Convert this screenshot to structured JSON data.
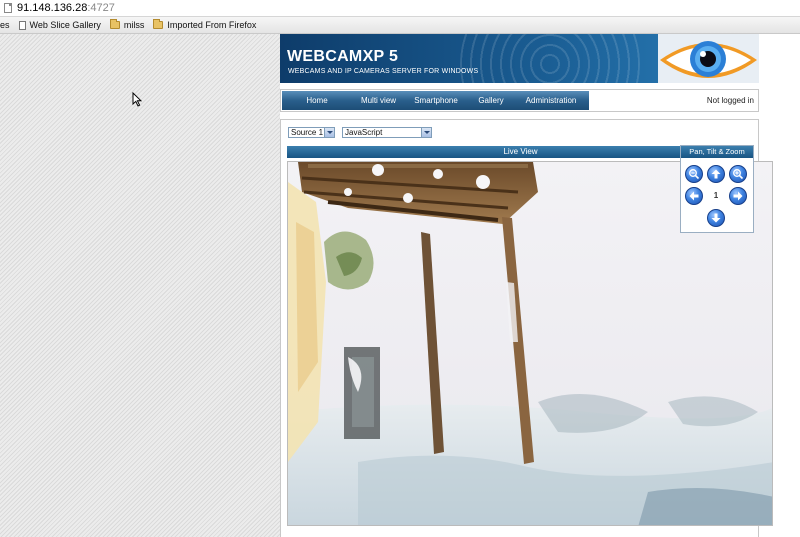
{
  "browser": {
    "url_host": "91.148.136.28",
    "url_port": ":4727",
    "favorites": [
      {
        "label": "es",
        "icon": "none"
      },
      {
        "label": "Web Slice Gallery",
        "icon": "page-icon"
      },
      {
        "label": "milss",
        "icon": "folder-icon"
      },
      {
        "label": "Imported From Firefox",
        "icon": "folder-icon"
      }
    ]
  },
  "banner": {
    "title": "WEBCAMXP 5",
    "subtitle": "WEBCAMS AND IP CAMERAS SERVER FOR WINDOWS",
    "logo_icon": "eye-logo-icon"
  },
  "nav": {
    "items": [
      "Home",
      "Multi view",
      "Smartphone",
      "Gallery",
      "Administration"
    ],
    "login_status": "Not logged in"
  },
  "controls": {
    "source_value": "Source 1",
    "mode_value": "JavaScript"
  },
  "live_view": {
    "title": "Live View"
  },
  "ptz": {
    "title": "Pan, Tilt & Zoom",
    "preset_number": "1",
    "icons": [
      "zoom-out-icon",
      "arrow-up-icon",
      "zoom-in-icon",
      "arrow-left-icon",
      "arrow-right-icon",
      "arrow-down-icon"
    ]
  },
  "colors": {
    "nav_bar": "#2a5f8c",
    "banner": "#1a5d93",
    "ptz_button": "#3e82e0",
    "eye_iris": "#2b7fd6",
    "eye_frame": "#f19a25"
  }
}
